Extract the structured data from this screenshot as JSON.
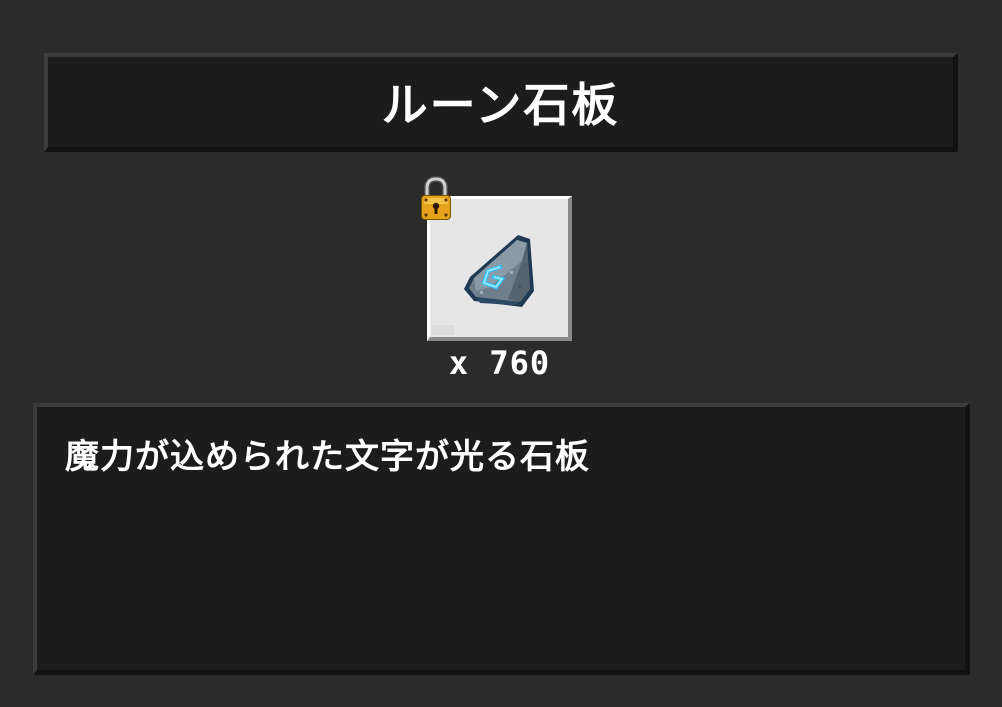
{
  "title": "ルーン石板",
  "item": {
    "icon": "rune-stone-tablet-icon",
    "locked": true,
    "lock_icon": "padlock-icon",
    "count_text": "x 760",
    "glow_color": "#2fc4ff"
  },
  "description": "魔力が込められた文字が光る石板"
}
